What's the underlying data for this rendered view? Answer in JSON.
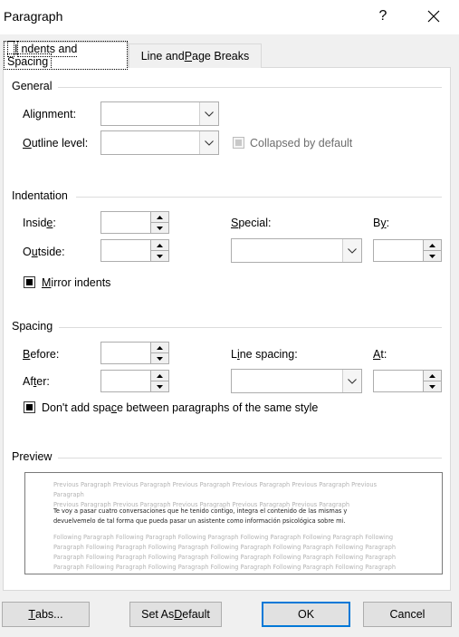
{
  "dialog": {
    "title": "Paragraph",
    "help_glyph": "?"
  },
  "tabs": [
    {
      "pre": "",
      "key": "I",
      "post": "ndents and Spacing"
    },
    {
      "pre": "Line and ",
      "key": "P",
      "post": "age Breaks"
    }
  ],
  "general": {
    "header": "General",
    "alignment": {
      "pre": "Ali",
      "key": "g",
      "post": "nment:",
      "value": ""
    },
    "outline_level": {
      "pre": "",
      "key": "O",
      "post": "utline level:",
      "value": ""
    },
    "collapsed_label": "Collapsed by default"
  },
  "indentation": {
    "header": "Indentation",
    "inside": {
      "pre": "Insid",
      "key": "e",
      "post": ":",
      "value": ""
    },
    "outside": {
      "pre": "O",
      "key": "u",
      "post": "tside:",
      "value": ""
    },
    "special": {
      "pre": "",
      "key": "S",
      "post": "pecial:",
      "value": ""
    },
    "by": {
      "pre": "B",
      "key": "y",
      "post": ":",
      "value": ""
    },
    "mirror": {
      "pre": "",
      "key": "M",
      "post": "irror indents"
    }
  },
  "spacing": {
    "header": "Spacing",
    "before": {
      "pre": "",
      "key": "B",
      "post": "efore:",
      "value": ""
    },
    "after": {
      "pre": "Af",
      "key": "t",
      "post": "er:",
      "value": ""
    },
    "line_spacing": {
      "pre": "L",
      "key": "i",
      "post": "ne spacing:",
      "value": ""
    },
    "at": {
      "pre": "",
      "key": "A",
      "post": "t:",
      "value": ""
    },
    "dont_add": {
      "pre": "Don't add spa",
      "key": "c",
      "post": "e between paragraphs of the same style"
    }
  },
  "preview": {
    "header": "Preview",
    "previous_lines": [
      "Previous Paragraph Previous Paragraph Previous Paragraph Previous Paragraph Previous Paragraph Previous Paragraph",
      "Previous Paragraph Previous Paragraph Previous Paragraph Previous Paragraph Previous Paragraph"
    ],
    "current_lines": [
      "Te voy a pasar cuatro conversaciones que he tenido contigo, integra el contenido de las mismas y",
      "devuelvemelo de tal forma que pueda pasar un asistente como información psicológica sobre mi."
    ],
    "following_lines": [
      "Following Paragraph Following Paragraph Following Paragraph Following Paragraph Following Paragraph Following",
      "Paragraph Following Paragraph Following Paragraph Following Paragraph Following Paragraph Following Paragraph",
      "Paragraph Following Paragraph Following Paragraph Following Paragraph Following Paragraph Following Paragraph",
      "Paragraph Following Paragraph Following Paragraph Following Paragraph Following Paragraph Following Paragraph",
      "Paragraph Following Paragraph Following Paragraph Following Paragraph Following Paragraph Following Paragraph"
    ]
  },
  "buttons": {
    "tabs": {
      "pre": "",
      "key": "T",
      "post": "abs..."
    },
    "set_default": {
      "pre": "Set As ",
      "key": "D",
      "post": "efault"
    },
    "ok": "OK",
    "cancel": "Cancel"
  },
  "colors": {
    "accent": "#0078d7",
    "panel": "#ffffff",
    "background": "#f0f0f0"
  }
}
